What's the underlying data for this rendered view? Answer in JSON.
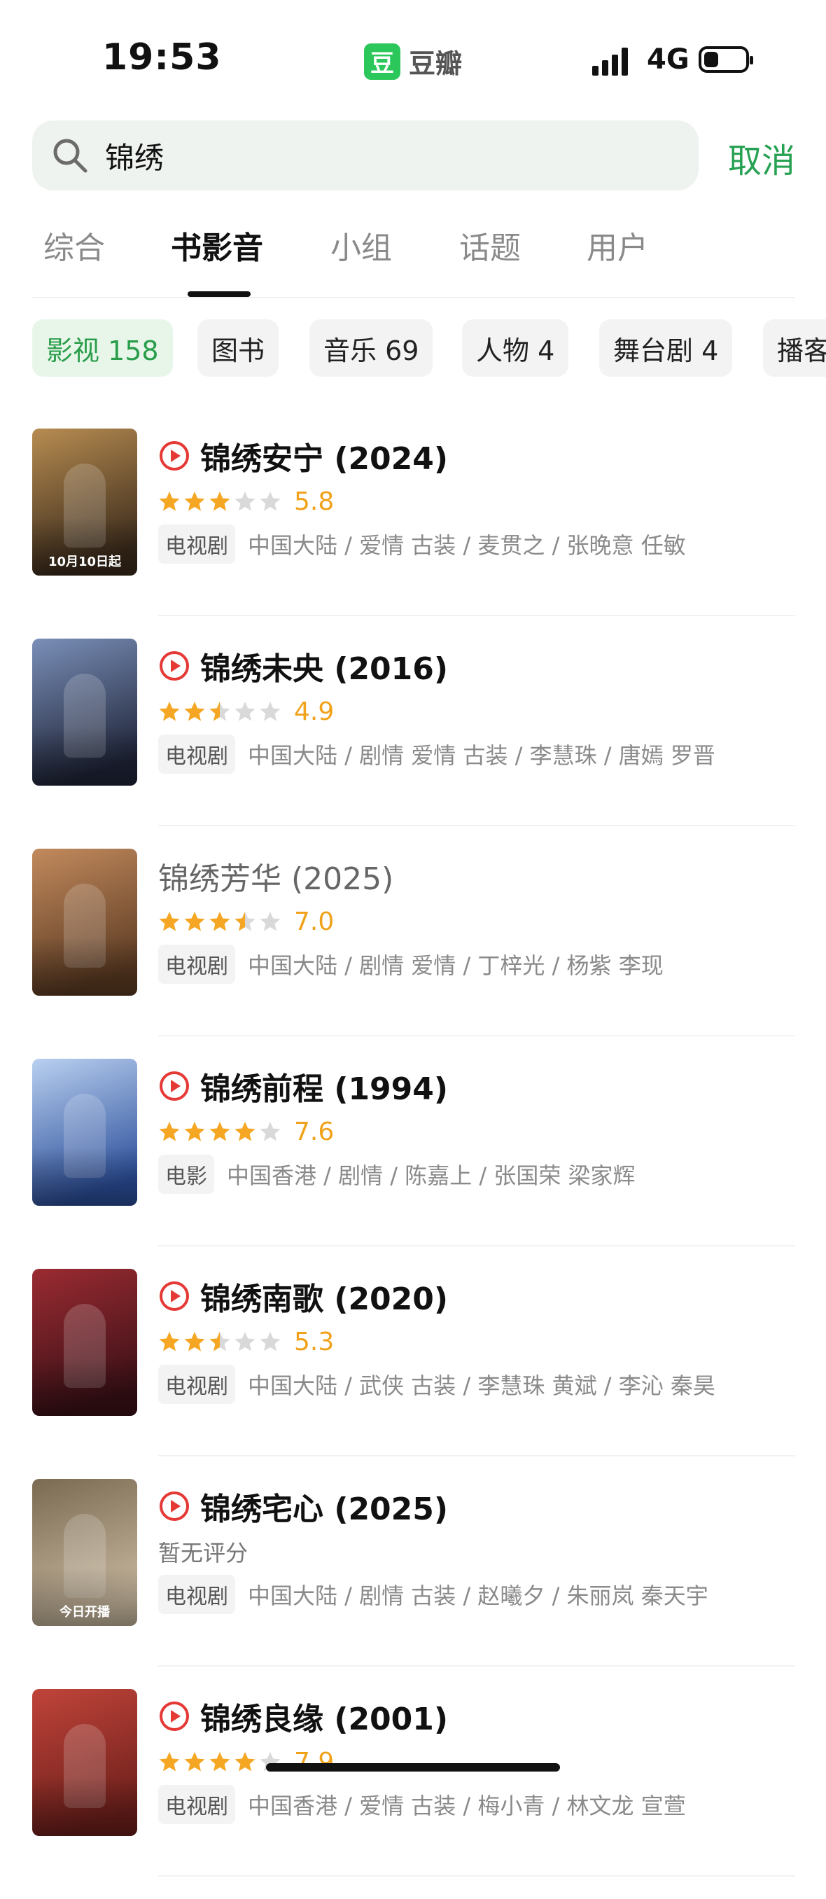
{
  "status_bar": {
    "time": "19:53",
    "app_name": "豆瓣",
    "app_logo": "豆",
    "network": "4G",
    "battery_level": 0.35
  },
  "search": {
    "query": "锦绣",
    "cancel_label": "取消"
  },
  "tabs": [
    {
      "label": "综合",
      "active": false
    },
    {
      "label": "书影音",
      "active": true
    },
    {
      "label": "小组",
      "active": false
    },
    {
      "label": "话题",
      "active": false
    },
    {
      "label": "用户",
      "active": false
    }
  ],
  "chips": [
    {
      "label": "影视 158",
      "active": true
    },
    {
      "label": "图书",
      "active": false
    },
    {
      "label": "音乐 69",
      "active": false
    },
    {
      "label": "人物 4",
      "active": false
    },
    {
      "label": "舞台剧 4",
      "active": false
    },
    {
      "label": "播客",
      "active": false
    }
  ],
  "results": [
    {
      "title": "锦绣安宁",
      "year": "(2024)",
      "playable": true,
      "stars": 3,
      "score": "5.8",
      "type": "电视剧",
      "meta": "中国大陆 / 爱情 古装 / 麦贯之 / 张晚意 任敏",
      "poster_caption": "10月10日起",
      "poster_colors": [
        "#3a2a1b",
        "#b78c51"
      ]
    },
    {
      "title": "锦绣未央",
      "year": "(2016)",
      "playable": true,
      "stars": 2.5,
      "score": "4.9",
      "type": "电视剧",
      "meta": "中国大陆 / 剧情 爱情 古装 / 李慧珠 / 唐嫣 罗晋",
      "poster_caption": "",
      "poster_colors": [
        "#1f2438",
        "#7a8fb8"
      ]
    },
    {
      "title": "锦绣芳华",
      "year": "(2025)",
      "playable": false,
      "stars": 3.5,
      "score": "7.0",
      "type": "电视剧",
      "meta": "中国大陆 / 剧情 爱情 / 丁梓光 / 杨紫 李现",
      "poster_caption": "",
      "poster_colors": [
        "#5b3a22",
        "#c28a5d"
      ]
    },
    {
      "title": "锦绣前程",
      "year": "(1994)",
      "playable": true,
      "stars": 4,
      "score": "7.6",
      "type": "电影",
      "meta": "中国香港 / 剧情 / 陈嘉上 / 张国荣 梁家辉",
      "poster_caption": "",
      "poster_colors": [
        "#2b4e9a",
        "#b9d0f0"
      ]
    },
    {
      "title": "锦绣南歌",
      "year": "(2020)",
      "playable": true,
      "stars": 2.5,
      "score": "5.3",
      "type": "电视剧",
      "meta": "中国大陆 / 武侠 古装 / 李慧珠 黄斌 / 李沁 秦昊",
      "poster_caption": "",
      "poster_colors": [
        "#3a1016",
        "#9b2b32"
      ]
    },
    {
      "title": "锦绣宅心",
      "year": "(2025)",
      "playable": true,
      "stars": 0,
      "score": "",
      "no_rating": "暂无评分",
      "type": "电视剧",
      "meta": "中国大陆 / 剧情 古装 / 赵曦夕 / 朱丽岚 秦天宇",
      "poster_caption": "今日开播",
      "poster_colors": [
        "#c8b89f",
        "#7a6a52"
      ]
    },
    {
      "title": "锦绣良缘",
      "year": "(2001)",
      "playable": true,
      "stars": 4,
      "score": "7.9",
      "type": "电视剧",
      "meta": "中国香港 / 爱情 古装 / 梅小青 / 林文龙 宣萱",
      "poster_caption": "",
      "poster_colors": [
        "#6d1f1b",
        "#c0443a"
      ]
    }
  ]
}
